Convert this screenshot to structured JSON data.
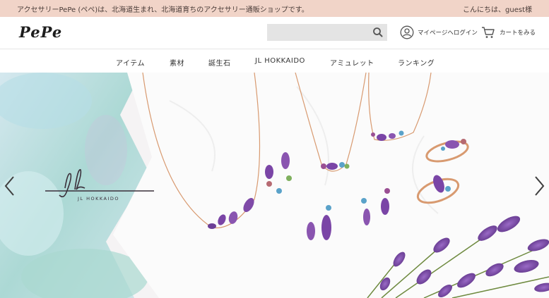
{
  "topbar": {
    "tagline": "アクセサリーPePe (ペペ)は、北海道生まれ、北海道育ちのアクセサリー通販ショップです。",
    "greeting": "こんにちは、guest様"
  },
  "header": {
    "logo_text": "PePe",
    "search_placeholder": "",
    "mypage_label": "マイページへログイン",
    "cart_label": "カートをみる"
  },
  "nav": {
    "items": [
      {
        "label": "アイテム"
      },
      {
        "label": "素材"
      },
      {
        "label": "誕生石"
      },
      {
        "label": "JL HOKKAIDO"
      },
      {
        "label": "アミュレット"
      },
      {
        "label": "ランキング"
      }
    ]
  },
  "hero": {
    "brand_caption": "JL HOKKAIDO",
    "brand_mark": "jl"
  },
  "colors": {
    "topbar_bg": "#f1d4c8",
    "search_bg": "#e4e4e4",
    "amethyst": "#7a3f9a",
    "rose_gold": "#d4956b",
    "lavender": "#8a5cb8"
  },
  "icons": {
    "search": "search-icon",
    "user": "user-circle-icon",
    "cart": "cart-icon",
    "prev": "chevron-left-icon",
    "next": "chevron-right-icon"
  }
}
